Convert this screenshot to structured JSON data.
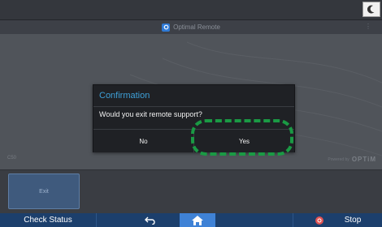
{
  "header": {
    "app_title": "Optimal Remote",
    "menu_dots": "⋮"
  },
  "app": {
    "left_code": "C50",
    "powered_by_label": "Powered by",
    "powered_by_brand": "OPTiM",
    "exit_label": "Exit"
  },
  "dialog": {
    "title": "Confirmation",
    "message": "Would you exit remote support?",
    "no_label": "No",
    "yes_label": "Yes"
  },
  "bottom_bar": {
    "check_status_label": "Check Status",
    "stop_label": "Stop"
  },
  "icons": {
    "night_mode": "moon-icon",
    "app_logo": "optimal-remote-logo-icon",
    "back": "back-arrow-icon",
    "home": "home-icon",
    "stop": "stop-icon"
  },
  "colors": {
    "accent_title": "#3ea0d8",
    "highlight": "#1a9a44",
    "bottom_bar": "#1c3f6c",
    "home_active": "#3f82d6",
    "stop": "#e25353"
  }
}
